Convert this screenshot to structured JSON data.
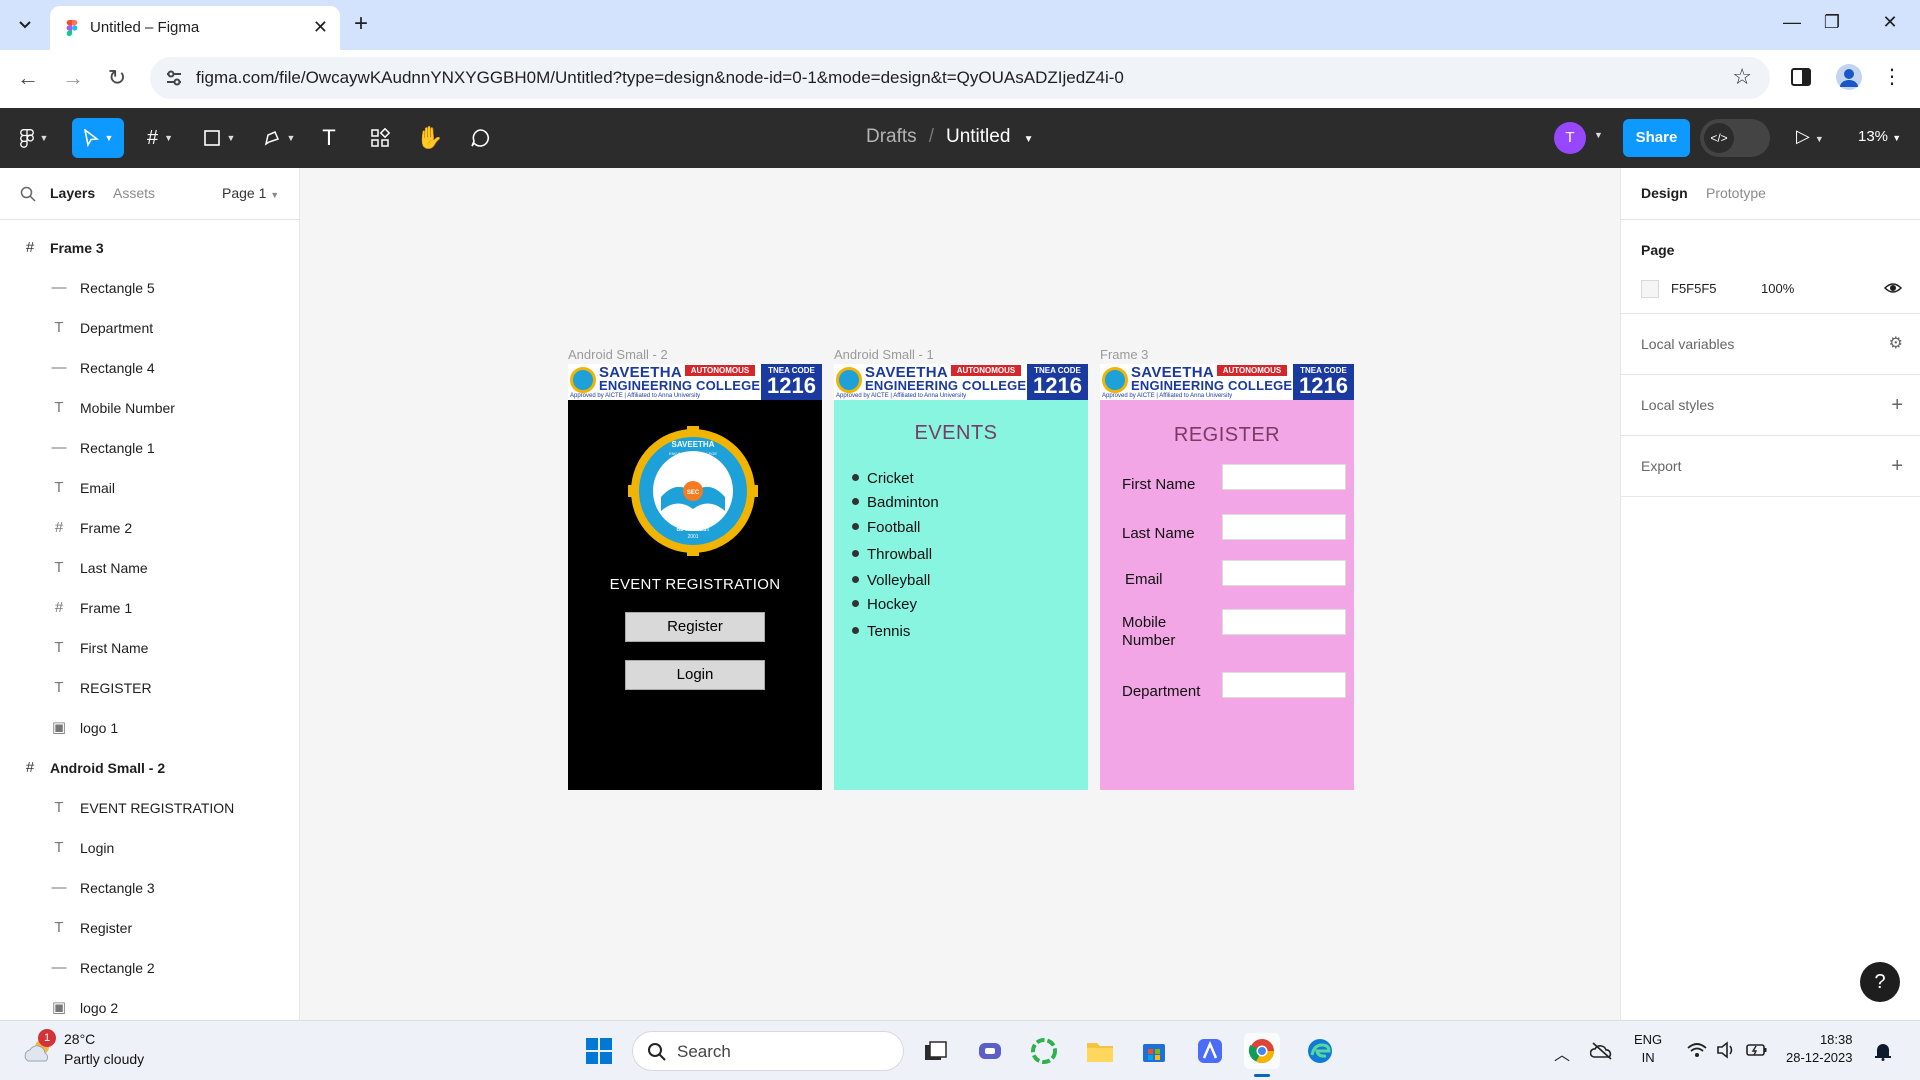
{
  "browser": {
    "tab_title": "Untitled – Figma",
    "tab_close": "✕",
    "new_tab": "+",
    "url": "figma.com/file/OwcaywKAudnnYNXYGGBH0M/Untitled?type=design&node-id=0-1&mode=design&t=QyOUAsADZIjedZ4i-0"
  },
  "figma_toolbar": {
    "breadcrumb_parent": "Drafts",
    "breadcrumb_separator": "/",
    "file_name": "Untitled",
    "avatar_initial": "T",
    "share_label": "Share",
    "zoom": "13%"
  },
  "layers_panel": {
    "tab_layers": "Layers",
    "tab_assets": "Assets",
    "page_select": "Page 1",
    "items": [
      {
        "label": "Frame 3",
        "kind": "frame",
        "level": "top"
      },
      {
        "label": "Rectangle 5",
        "kind": "rect",
        "level": "child"
      },
      {
        "label": "Department",
        "kind": "text",
        "level": "child"
      },
      {
        "label": "Rectangle 4",
        "kind": "rect",
        "level": "child"
      },
      {
        "label": "Mobile Number",
        "kind": "text",
        "level": "child"
      },
      {
        "label": "Rectangle 1",
        "kind": "rect",
        "level": "child"
      },
      {
        "label": "Email",
        "kind": "text",
        "level": "child"
      },
      {
        "label": "Frame 2",
        "kind": "frame",
        "level": "child"
      },
      {
        "label": "Last Name",
        "kind": "text",
        "level": "child"
      },
      {
        "label": "Frame 1",
        "kind": "frame",
        "level": "child"
      },
      {
        "label": "First Name",
        "kind": "text",
        "level": "child"
      },
      {
        "label": "REGISTER",
        "kind": "text",
        "level": "child"
      },
      {
        "label": "logo 1",
        "kind": "image",
        "level": "child"
      },
      {
        "label": "Android Small - 2",
        "kind": "frame",
        "level": "top"
      },
      {
        "label": "EVENT REGISTRATION",
        "kind": "text",
        "level": "child"
      },
      {
        "label": "Login",
        "kind": "text",
        "level": "child"
      },
      {
        "label": "Rectangle 3",
        "kind": "rect",
        "level": "child"
      },
      {
        "label": "Register",
        "kind": "text",
        "level": "child"
      },
      {
        "label": "Rectangle 2",
        "kind": "rect",
        "level": "child"
      },
      {
        "label": "logo 2",
        "kind": "image",
        "level": "child"
      }
    ]
  },
  "canvas": {
    "frame_labels": [
      "Android Small - 2",
      "Android Small - 1",
      "Frame 3"
    ],
    "banner": {
      "name_line1": "SAVEETHA",
      "autonomous": "AUTONOMOUS",
      "name_line2": "ENGINEERING COLLEGE",
      "subline": "Approved by AICTE | Affiliated to Anna University",
      "code_label": "TNEA CODE",
      "code_number": "1216"
    },
    "logo_text": {
      "top": "SAVEETHA",
      "sub": "ENGINEERING COLLEGE",
      "center": "SEC",
      "motto": "BE THE BEST",
      "year": "2001"
    },
    "login_frame": {
      "title": "EVENT REGISTRATION",
      "register_button": "Register",
      "login_button": "Login"
    },
    "events_frame": {
      "title": "EVENTS",
      "events": [
        "Cricket",
        "Badminton",
        "Football",
        "Throwball",
        "Volleyball",
        "Hockey",
        "Tennis"
      ]
    },
    "register_frame": {
      "title": "REGISTER",
      "fields": [
        "First Name",
        "Last Name",
        "Email",
        "Mobile\nNumber",
        "Department"
      ]
    },
    "colors": {
      "login_bg": "#000000",
      "events_bg": "#88f5e0",
      "register_bg": "#f2a6e6"
    }
  },
  "right_panel": {
    "tab_design": "Design",
    "tab_prototype": "Prototype",
    "page_section": "Page",
    "page_color": "F5F5F5",
    "page_opacity": "100%",
    "local_variables": "Local variables",
    "local_styles": "Local styles",
    "export": "Export",
    "help": "?"
  },
  "taskbar": {
    "weather_badge": "1",
    "temperature": "28°C",
    "weather": "Partly cloudy",
    "search_placeholder": "Search",
    "lang_line1": "ENG",
    "lang_line2": "IN",
    "time": "18:38",
    "date": "28-12-2023"
  }
}
